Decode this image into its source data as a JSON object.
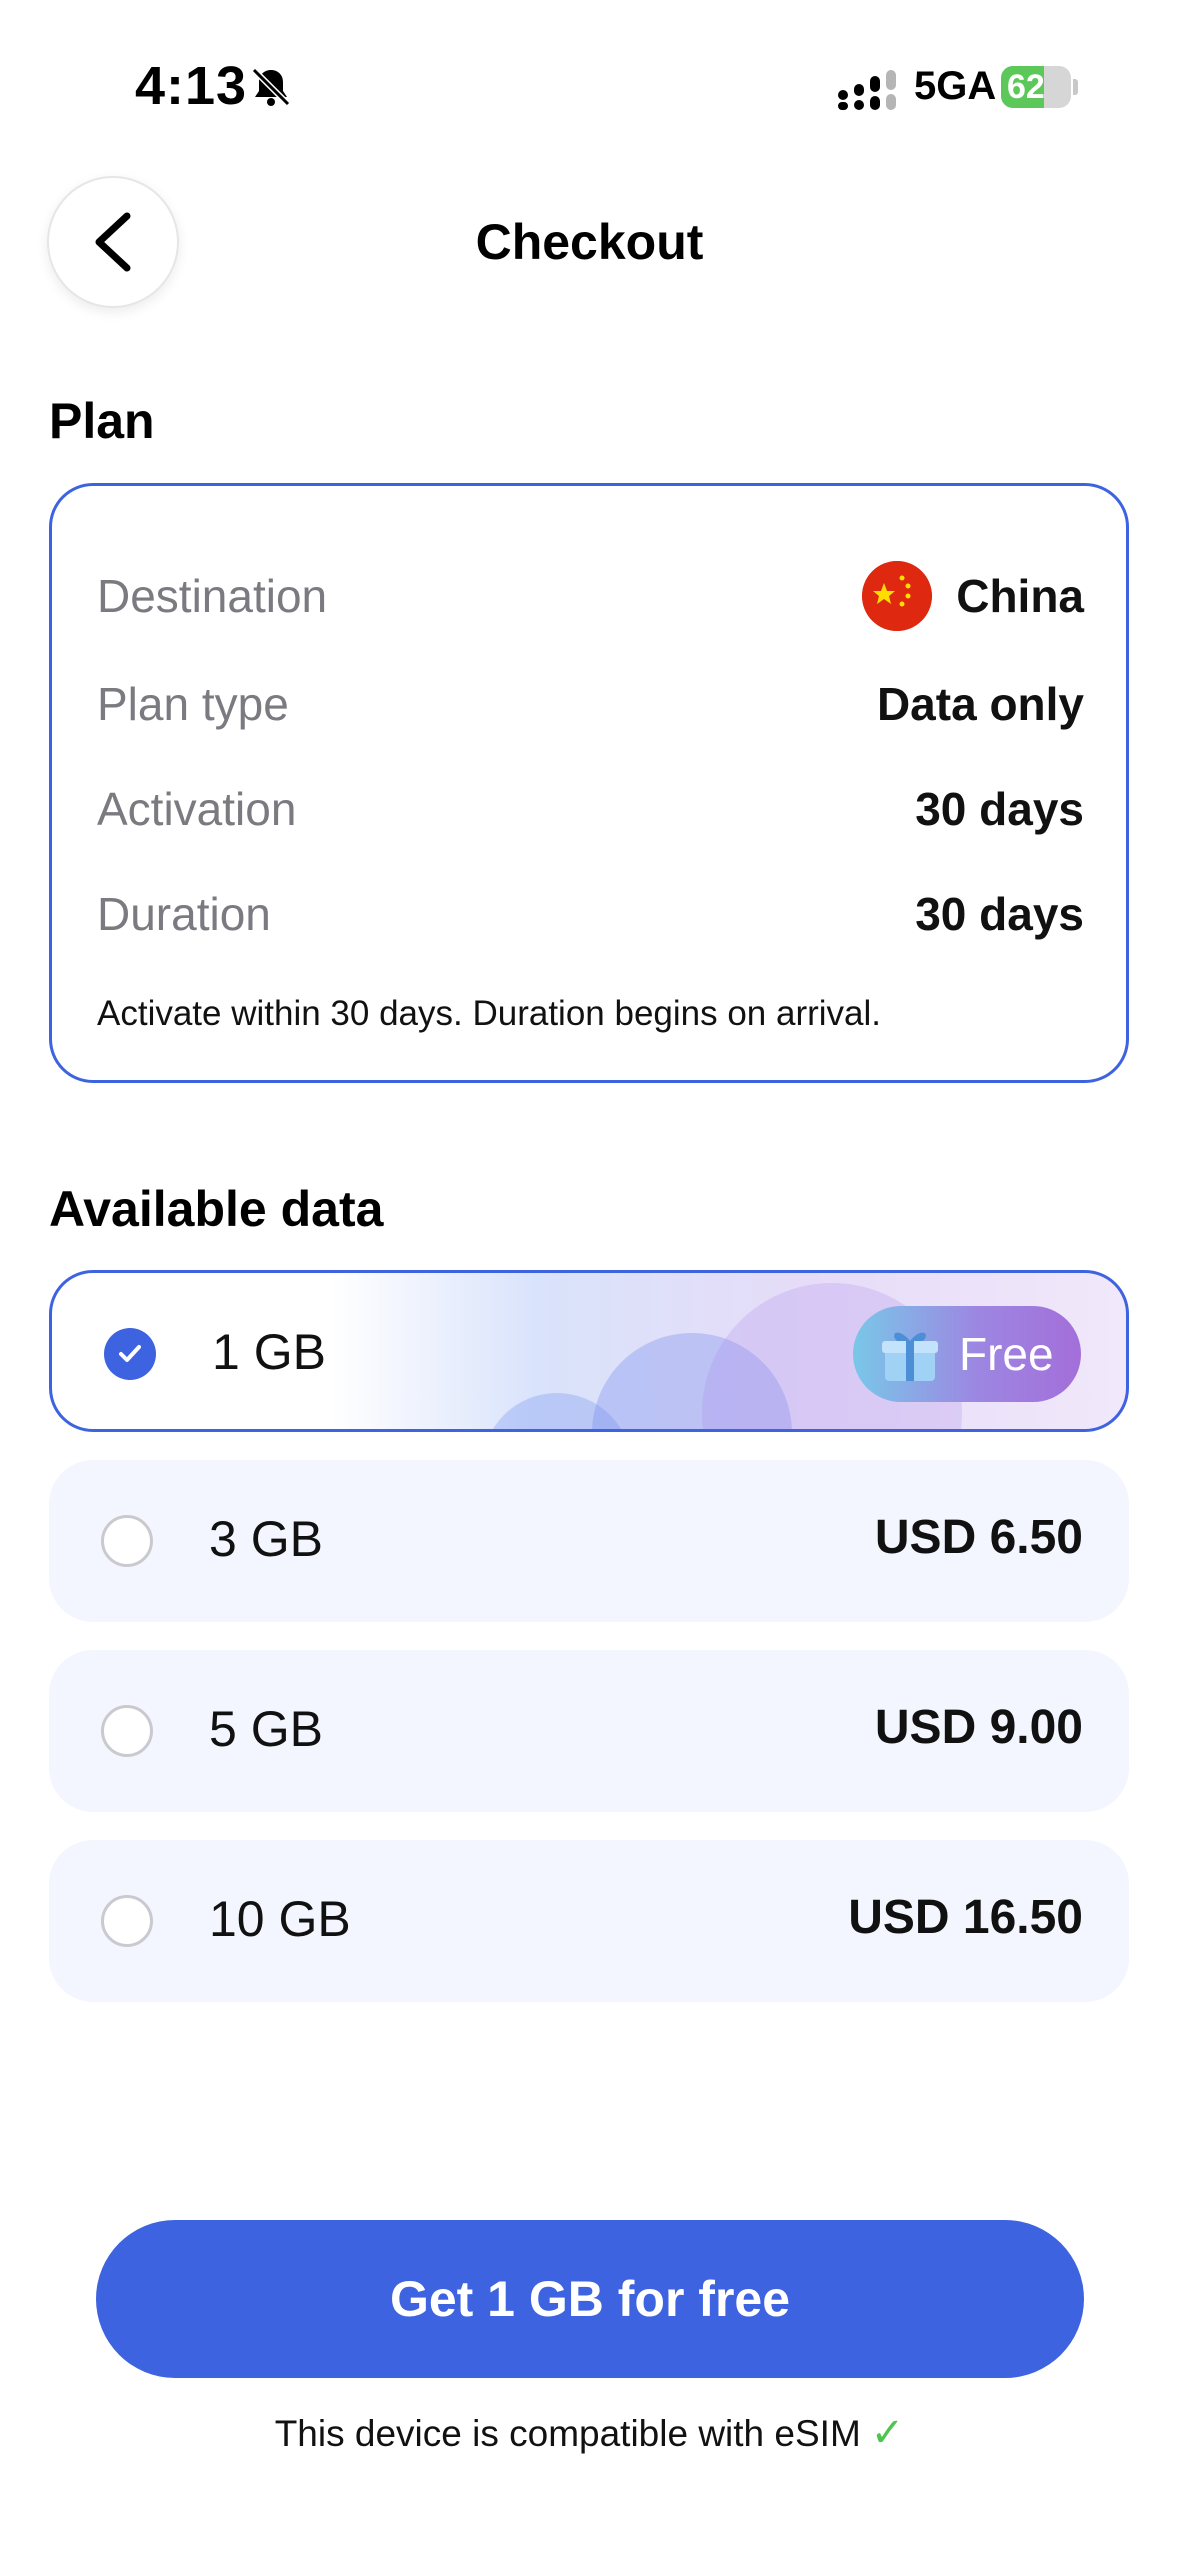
{
  "status_bar": {
    "time": "4:13",
    "network": "5GA",
    "battery": "62",
    "battery_level": 0.62,
    "icons": [
      "bell-slash-icon",
      "signal-icon",
      "battery-charging-icon"
    ]
  },
  "header": {
    "title": "Checkout",
    "back_icon": "chevron-left-icon"
  },
  "plan": {
    "section_title": "Plan",
    "rows": [
      {
        "label": "Destination",
        "value": "China",
        "icon": "china-flag-icon"
      },
      {
        "label": "Plan type",
        "value": "Data only"
      },
      {
        "label": "Activation",
        "value": "30 days"
      },
      {
        "label": "Duration",
        "value": "30 days"
      }
    ],
    "note": "Activate within 30 days. Duration begins on arrival."
  },
  "data": {
    "section_title": "Available data",
    "options": [
      {
        "label": "1 GB",
        "price": "Free",
        "selected": true,
        "badge_icon": "gift-icon"
      },
      {
        "label": "3 GB",
        "price": "USD 6.50",
        "selected": false
      },
      {
        "label": "5 GB",
        "price": "USD 9.00",
        "selected": false
      },
      {
        "label": "10 GB",
        "price": "USD 16.50",
        "selected": false
      }
    ]
  },
  "cta": {
    "label": "Get 1 GB for free",
    "compat_text": "This device is compatible with eSIM",
    "compat_mark": "✓"
  },
  "colors": {
    "accent": "#3d63e0",
    "option_bg": "#f3f6fe",
    "label_gray": "#7a7a80",
    "battery_green": "#5cc85a",
    "check_green": "#4fc44f"
  }
}
